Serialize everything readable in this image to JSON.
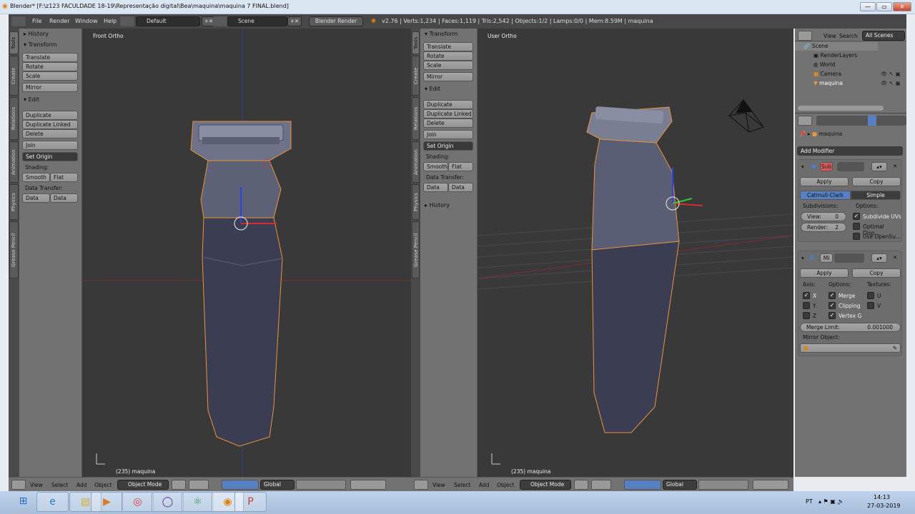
{
  "window": {
    "title": "Blender* [F:\\z123 FACULDADE 18-19\\Representação digital\\Bea\\maquina\\maquina 7 FINAL.blend]",
    "min": "—",
    "max": "▭",
    "close": "✕"
  },
  "info_header": {
    "menus": [
      "File",
      "Render",
      "Window",
      "Help"
    ],
    "layout": "Default",
    "scene": "Scene",
    "engine": "Blender Render",
    "stats": "v2.76 | Verts:1,234 | Faces:1,119 | Tris:2,542 | Objects:1/2 | Lamps:0/0 | Mem:8.59M | maquina"
  },
  "toolshelf": {
    "tabs": [
      "Tools",
      "Create",
      "Relations",
      "Animation",
      "Physics",
      "Grease Pencil"
    ],
    "history": "History",
    "transform": "Transform",
    "translate": "Translate",
    "rotate": "Rotate",
    "scale": "Scale",
    "mirror": "Mirror",
    "edit": "Edit",
    "duplicate": "Duplicate",
    "duplicate_linked": "Duplicate Linked",
    "delete": "Delete",
    "join": "Join",
    "set_origin": "Set Origin",
    "shading": "Shading:",
    "smooth": "Smooth",
    "flat": "Flat",
    "data_transfer": "Data Transfer:",
    "data": "Data",
    "data_layout_left": "Data Layo",
    "data_layout_right": "Data Lay"
  },
  "left_view": {
    "label": "Front Ortho",
    "object": "(235) maquina"
  },
  "right_view": {
    "label": "User Ortho",
    "object": "(235) maquina"
  },
  "view_header": {
    "menus": [
      "View",
      "Select",
      "Add",
      "Object"
    ],
    "mode": "Object Mode",
    "orientation": "Global"
  },
  "outliner": {
    "menus": [
      "View",
      "Search"
    ],
    "filter": "All Scenes",
    "items": [
      "Scene",
      "RenderLayers",
      "World",
      "Camera",
      "maquina"
    ]
  },
  "properties": {
    "breadcrumb": "maquina",
    "add_modifier": "Add Modifier",
    "sub": {
      "name": "Sub",
      "apply": "Apply",
      "copy": "Copy",
      "catmull": "Catmull-Clark",
      "simple": "Simple",
      "subdivisions": "Subdivisions:",
      "options": "Options:",
      "view_label": "View:",
      "view_value": "0",
      "render_label": "Render:",
      "render_value": "2",
      "subdivide_uvs": "Subdivide UVs",
      "subdivide_uvs_checked": true,
      "optimal": "Optimal Disp...",
      "opensubdiv": "Use OpenSu..."
    },
    "mirror": {
      "name": "Mi",
      "apply": "Apply",
      "copy": "Copy",
      "axis": "Axis:",
      "options": "Options:",
      "textures": "Textures:",
      "x": "X",
      "y": "Y",
      "z": "Z",
      "merge": "Merge",
      "clipping": "Clipping",
      "vertex_groups": "Vertex G",
      "u": "U",
      "v": "V",
      "merge_limit_label": "Merge Limit:",
      "merge_limit": "0.001000",
      "mirror_object": "Mirror Object:"
    }
  },
  "taskbar": {
    "apps": [
      "start",
      "internet-explorer",
      "file-explorer",
      "media-player",
      "chrome",
      "app-purple",
      "atom",
      "blender",
      "powerpoint"
    ],
    "lang": "PT",
    "time": "14:13",
    "date": "27-03-2019"
  },
  "colors": {
    "accent": "#5680c2",
    "selection": "#f0a33c",
    "viewport": "#393939"
  }
}
